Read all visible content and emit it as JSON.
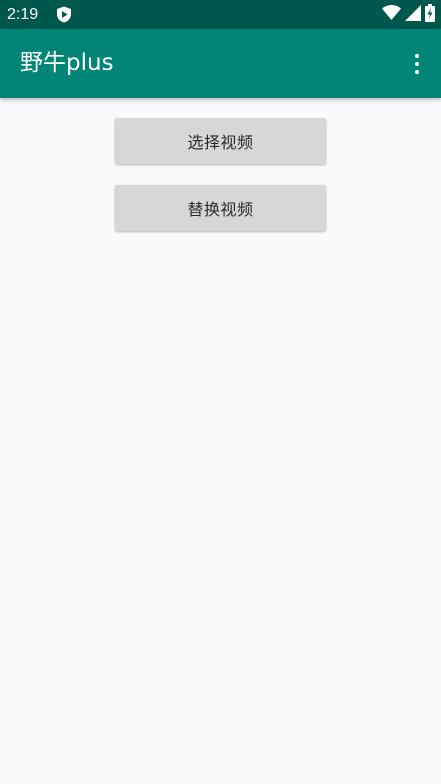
{
  "status_bar": {
    "time": "2:19",
    "left_icon": "shield-play-icon",
    "right_icons": [
      "wifi-icon",
      "cell-signal-icon",
      "battery-charging-icon"
    ],
    "background": "#00574b"
  },
  "app_bar": {
    "title": "野牛plus",
    "background": "#008577",
    "overflow_icon": "more-vert-icon"
  },
  "main": {
    "select_video_label": "选择视频",
    "replace_video_label": "替换视频",
    "button_background": "#d6d7d7"
  }
}
